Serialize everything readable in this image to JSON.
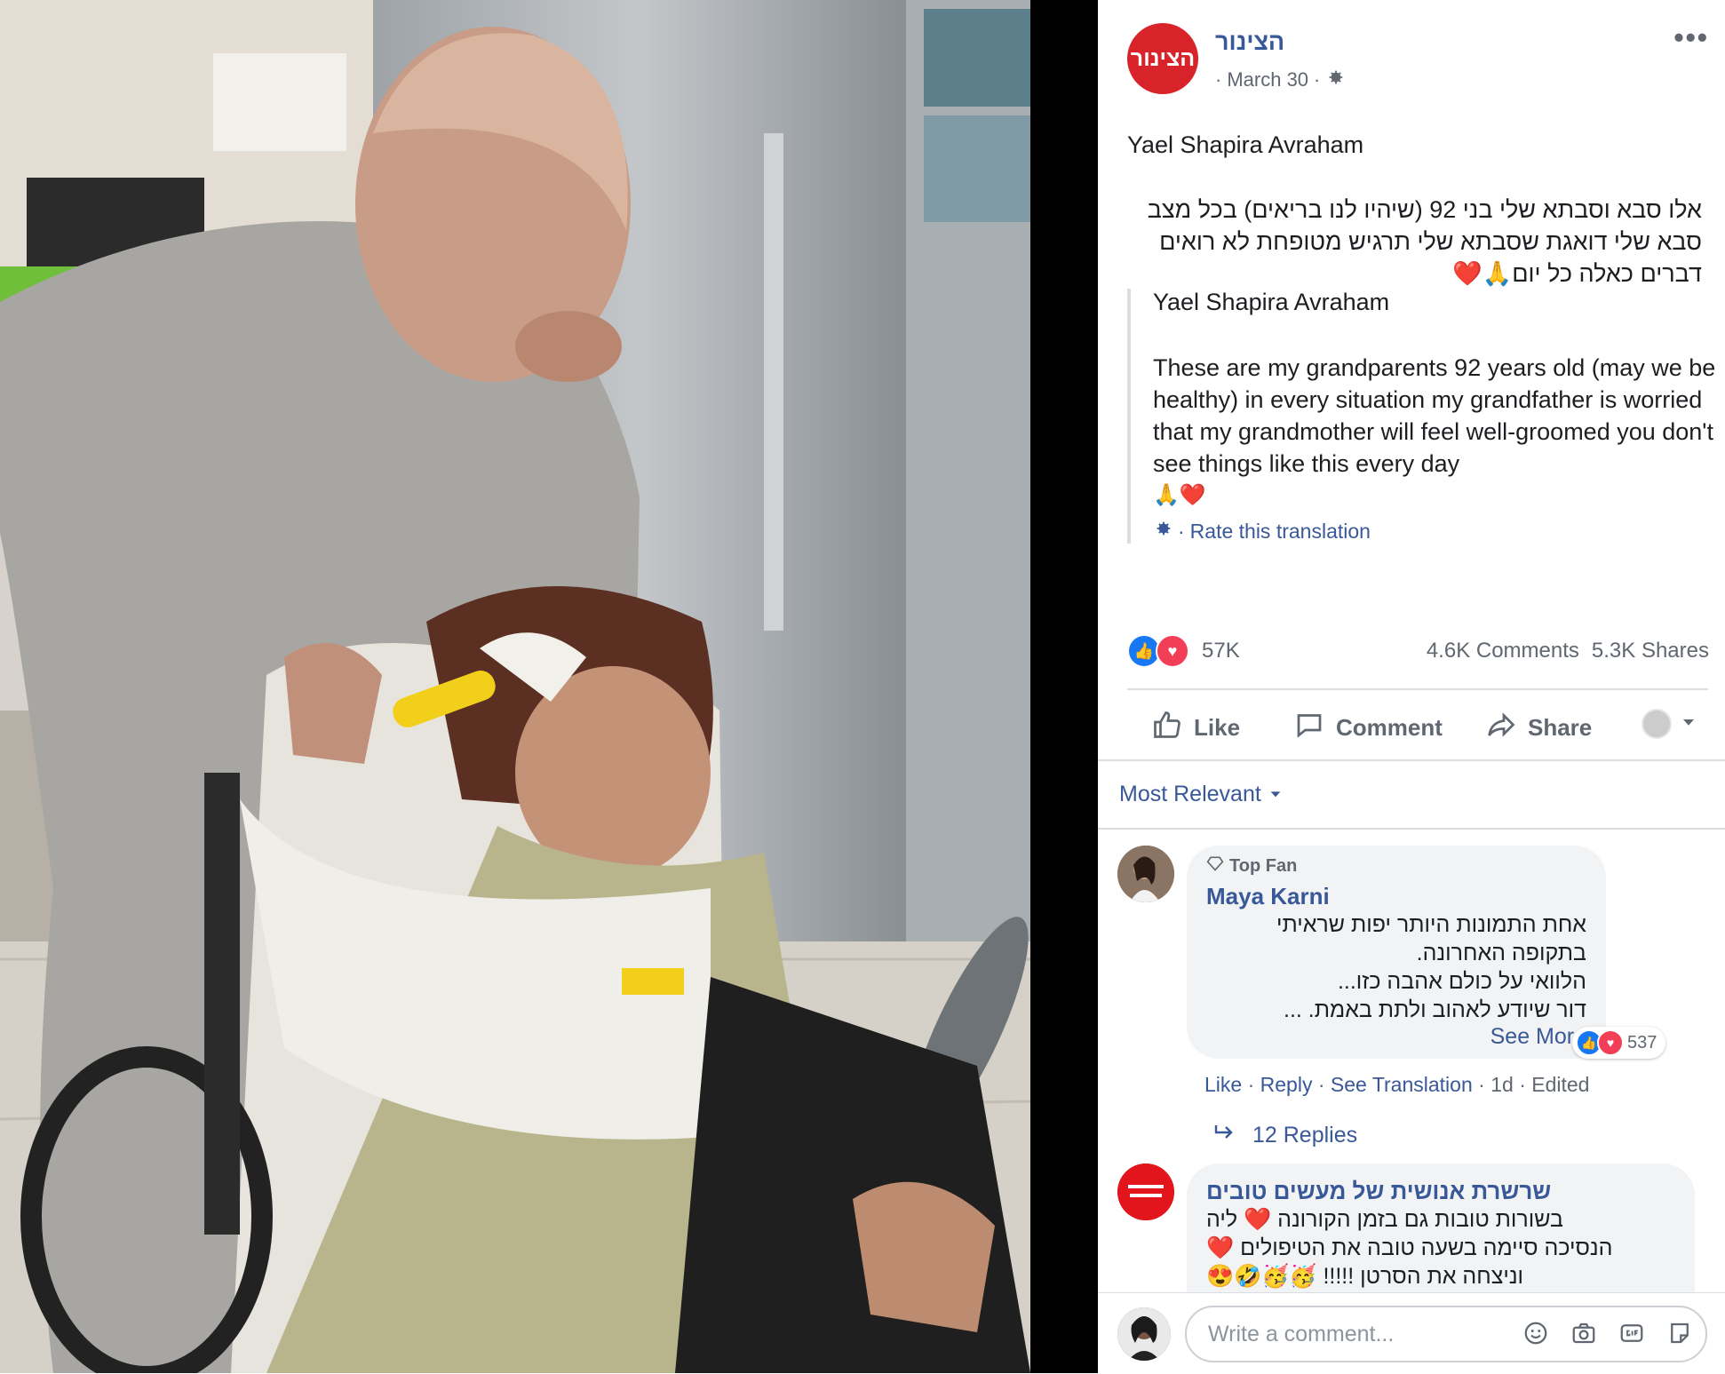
{
  "post": {
    "page_name": "הצינור",
    "logo_text": "הצינור",
    "date": "March 30",
    "more_label": "•••",
    "author": "Yael Shapira Avraham",
    "hebrew_text": "אלו סבא וסבתא שלי בני 92 (שיהיו לנו בריאים) בכל מצב סבא שלי דואגת שסבתא שלי תרגיש מטופחת לא רואים דברים כאלה כל יום🙏❤️",
    "translation": {
      "author": "Yael Shapira Avraham",
      "text": "These are my grandparents 92 years old (may we be healthy) in every situation my grandfather is worried that my grandmother will feel well-groomed you don't see things like this every day",
      "emoji": "🙏❤️",
      "rate_label": "Rate this translation"
    }
  },
  "stats": {
    "reactions": "57K",
    "comments": "4.6K Comments",
    "shares": "5.3K Shares"
  },
  "actions": {
    "like": "Like",
    "comment": "Comment",
    "share": "Share"
  },
  "sort_label": "Most Relevant",
  "comments": [
    {
      "badge": "Top Fan",
      "name": "Maya Karni",
      "lines": [
        "אחת התמונות היותר יפות שראיתי",
        "בתקופה האחרונה.",
        "הלוואי על כולם אהבה כזו...",
        "דור שיודע לאהוב ולתת באמת. ..."
      ],
      "see_more": "See More",
      "reaction_count": "537",
      "meta": {
        "like": "Like",
        "reply": "Reply",
        "see_translation": "See Translation",
        "time": "1d",
        "edited": "Edited"
      },
      "replies": "12 Replies"
    },
    {
      "name": "שרשרת אנושית של מעשים טובים",
      "avatar_text": "שרשרת אנושית של מעשים טובים",
      "lines": [
        "בשורות טובות גם בזמן הקורונה ❤️ ליה",
        "הנסיכה סיימה בשעה טובה את הטיפולים ❤️",
        "וניצחה את הסרטן !!!!! 🥳🥳🤣😍"
      ]
    }
  ],
  "composer": {
    "placeholder": "Write a comment..."
  },
  "colors": {
    "link": "#385898",
    "brand_red": "#d8232a",
    "like_blue": "#1877f2",
    "love_red": "#f33e58"
  }
}
